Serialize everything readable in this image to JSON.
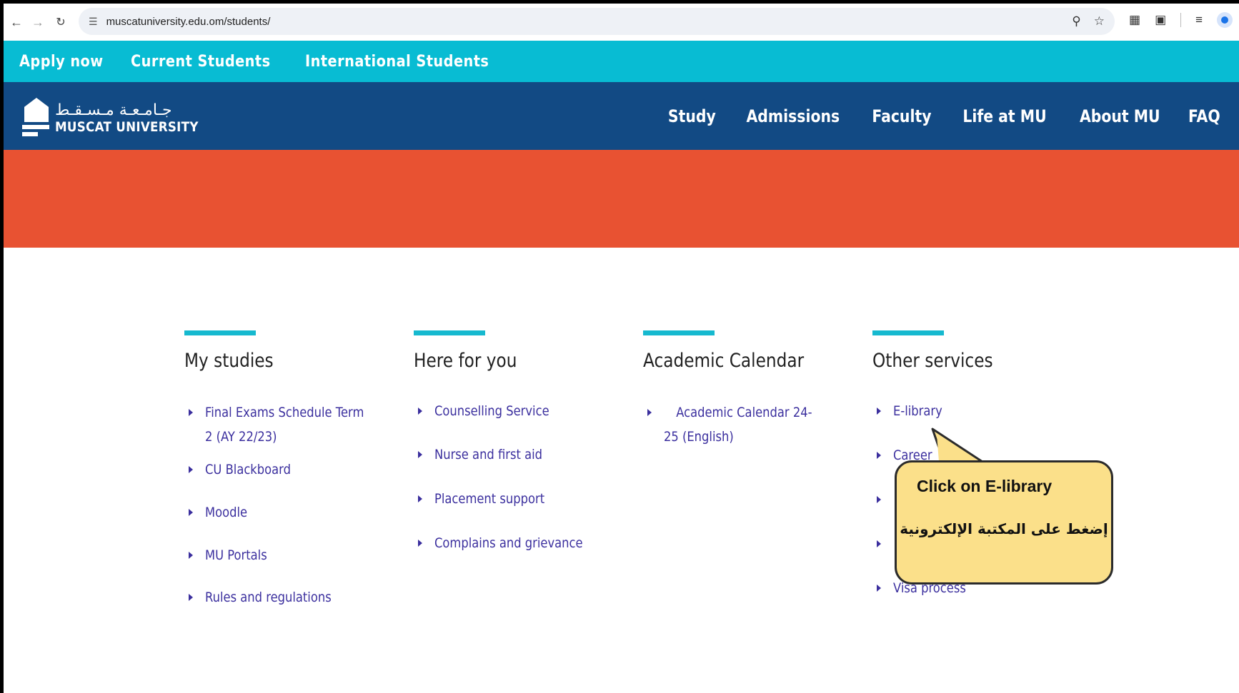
{
  "browser": {
    "url": "muscatuniversity.edu.om/students/",
    "icons": [
      "back-icon",
      "forward-icon",
      "reload-icon",
      "site-settings-icon",
      "zoom-icon",
      "star-icon",
      "extension-icon",
      "puzzle-icon",
      "reading-list-icon",
      "profile-icon",
      "menu-icon"
    ]
  },
  "topbar": {
    "links": [
      "Apply now",
      "Current Students",
      "International Students"
    ]
  },
  "header": {
    "logo_ar": "جـامـعـة مـسـقـط",
    "logo_en": "MUSCAT UNIVERSITY",
    "nav": [
      "Study",
      "Admissions",
      "Faculty",
      "Life at MU",
      "About MU",
      "FAQ"
    ]
  },
  "colors": {
    "topbar": "#08bcd3",
    "header": "#124a84",
    "hero": "#e85232",
    "accent": "#16b9cf",
    "link": "#3b2f9e",
    "callout": "#fbe08a"
  },
  "columns": [
    {
      "title": "My studies",
      "items": [
        "Final Exams Schedule Term 2 (AY 22/23)",
        "CU Blackboard",
        "Moodle",
        "MU Portals",
        "Rules and regulations"
      ]
    },
    {
      "title": "Here for you",
      "items": [
        "Counselling Service",
        "Nurse and first aid",
        "Placement support",
        "Complains and grievance"
      ]
    },
    {
      "title": "Academic Calendar",
      "items": [
        "Academic Calendar 24-25 (English)"
      ]
    },
    {
      "title": "Other services",
      "items": [
        "E-library",
        "Career",
        "",
        "",
        "Visa process"
      ]
    }
  ],
  "callout": {
    "en": "Click on E-library",
    "ar": "إضغط على المكتبة الإلكترونية"
  }
}
